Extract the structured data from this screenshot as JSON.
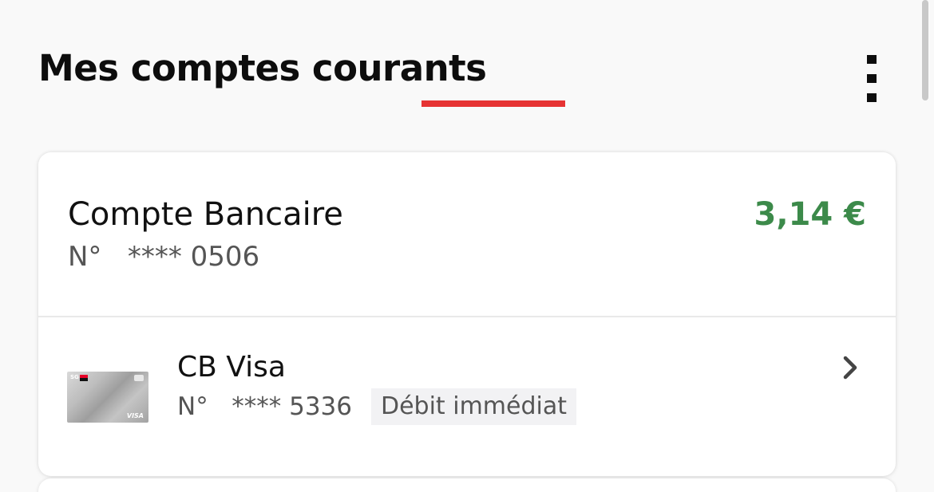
{
  "header": {
    "title": "Mes comptes courants",
    "accent_color": "#e63333",
    "menu_icon": "more-vertical-icon"
  },
  "account": {
    "name": "Compte Bancaire",
    "number": "N°   **** 0506",
    "balance": "3,14 €",
    "balance_color": "#3c8a4a"
  },
  "bank_card": {
    "name": "CB Visa",
    "number": "N°   **** 5336",
    "debit_type": "Débit immédiat",
    "image_icon": "visa-card-image",
    "chevron_icon": "chevron-right-icon"
  }
}
